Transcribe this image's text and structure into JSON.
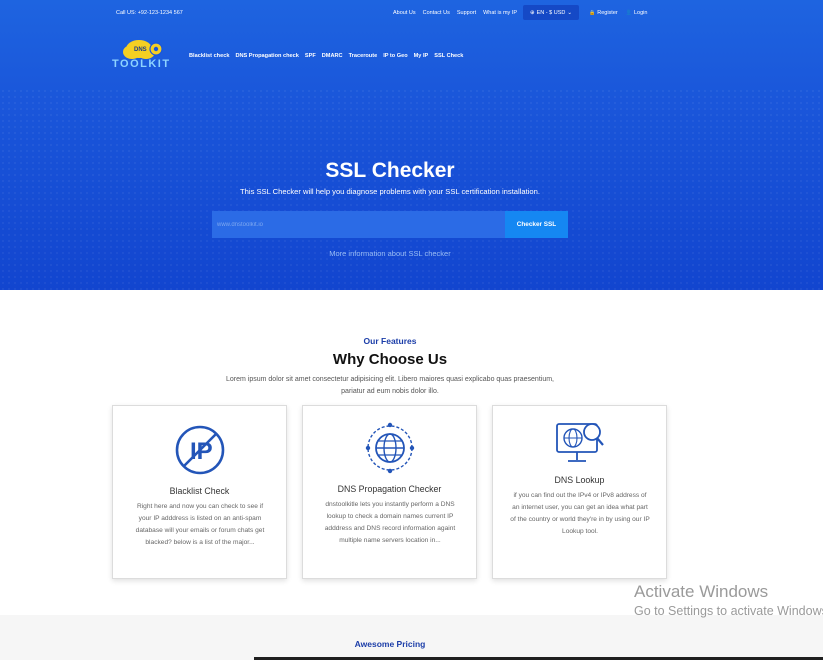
{
  "topbar": {
    "call": "Call US: +92-123-1234 567",
    "links": [
      "About Us",
      "Contact Us",
      "Support",
      "What is my IP"
    ],
    "language": "EN - $ USD",
    "register": "Register",
    "login": "Login"
  },
  "logo": {
    "badge": "DNS",
    "text": "TOOLKIT"
  },
  "nav": [
    "Blacklist check",
    "DNS Propagation check",
    "SPF",
    "DMARC",
    "Traceroute",
    "IP to Geo",
    "My IP",
    "SSL Check"
  ],
  "hero": {
    "title": "SSL Checker",
    "subtitle": "This SSL Checker will help you diagnose problems with your SSL certification installation.",
    "placeholder": "www.dnstoolkit.io",
    "button": "Checker SSL",
    "more": "More information about SSL checker"
  },
  "features": {
    "label": "Our Features",
    "title": "Why Choose Us",
    "description": "Lorem ipsum dolor sit amet consectetur adipisicing elit. Libero maiores quasi explicabo quas praesentium, pariatur ad eum nobis dolor illo.",
    "cards": [
      {
        "icon": "blocked-ip-icon",
        "title": "Blacklist Check",
        "text": "Right here and now you can check to see if your IP adddress is listed on an anti-spam database will your emails or forum chats get blacked? below is a list of the major..."
      },
      {
        "icon": "globe-network-icon",
        "title": "DNS Propagation Checker",
        "text": "dnstoolkitle lets you instantly perform a DNS lookup to check a domain names current IP adddress and DNS record information againt multiple name servers location in..."
      },
      {
        "icon": "monitor-search-icon",
        "title": "DNS Lookup",
        "text": "if you can find out the IPv4 or IPv8 address of an internet user, you can get an idea what part of the country or world they're in by using our IP Lookup tool."
      }
    ]
  },
  "pricing": {
    "label": "Awesome Pricing"
  },
  "watermark": {
    "title": "Activate Windows",
    "subtitle": "Go to Settings to activate Windows."
  },
  "colors": {
    "hero": "#1a56da",
    "accent": "#1587f2",
    "heading_blue": "#1b3da8"
  }
}
